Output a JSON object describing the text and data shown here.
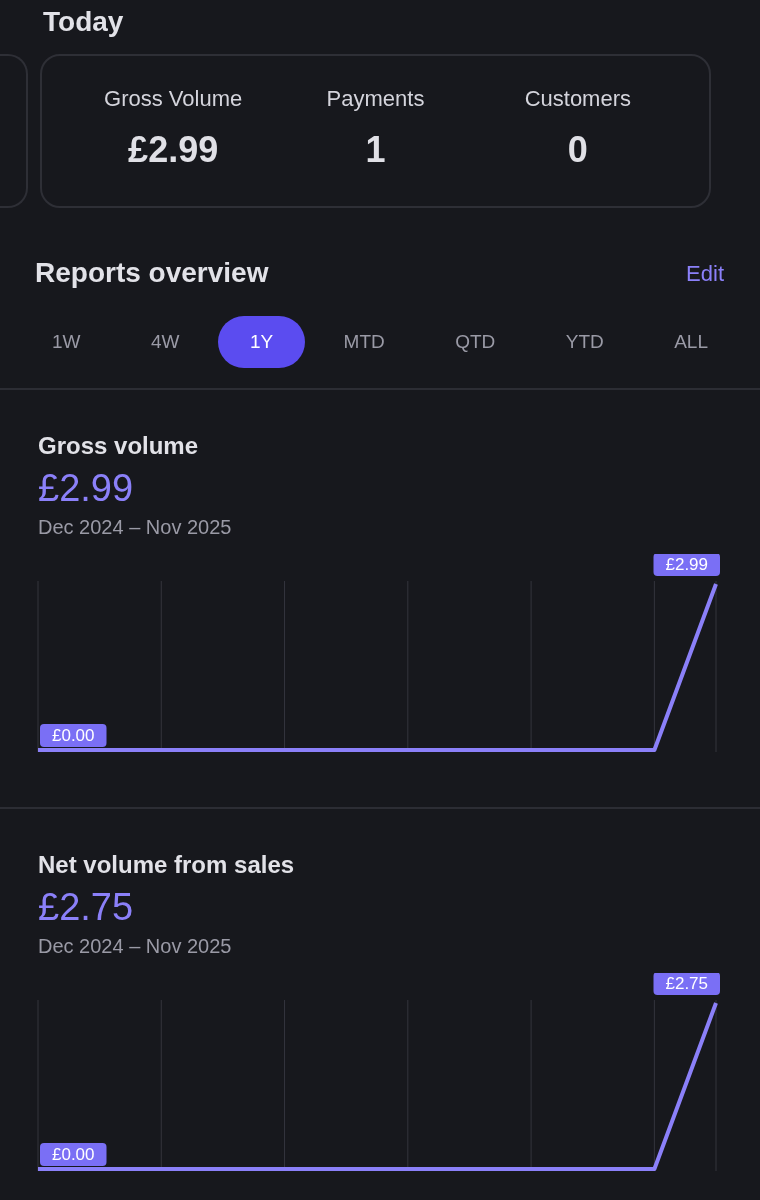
{
  "today": {
    "title": "Today",
    "stats": [
      {
        "label": "Gross Volume",
        "value": "£2.99"
      },
      {
        "label": "Payments",
        "value": "1"
      },
      {
        "label": "Customers",
        "value": "0"
      }
    ]
  },
  "reports": {
    "title": "Reports overview",
    "edit": "Edit",
    "tabs": [
      {
        "label": "1W",
        "selected": false
      },
      {
        "label": "4W",
        "selected": false
      },
      {
        "label": "1Y",
        "selected": true
      },
      {
        "label": "MTD",
        "selected": false
      },
      {
        "label": "QTD",
        "selected": false
      },
      {
        "label": "YTD",
        "selected": false
      },
      {
        "label": "ALL",
        "selected": false
      }
    ]
  },
  "charts": [
    {
      "title": "Gross volume",
      "total": "£2.99",
      "range": "Dec 2024 – Nov 2025",
      "start_label": "£0.00",
      "end_label": "£2.99"
    },
    {
      "title": "Net volume from sales",
      "total": "£2.75",
      "range": "Dec 2024 – Nov 2025",
      "start_label": "£0.00",
      "end_label": "£2.75"
    }
  ]
}
